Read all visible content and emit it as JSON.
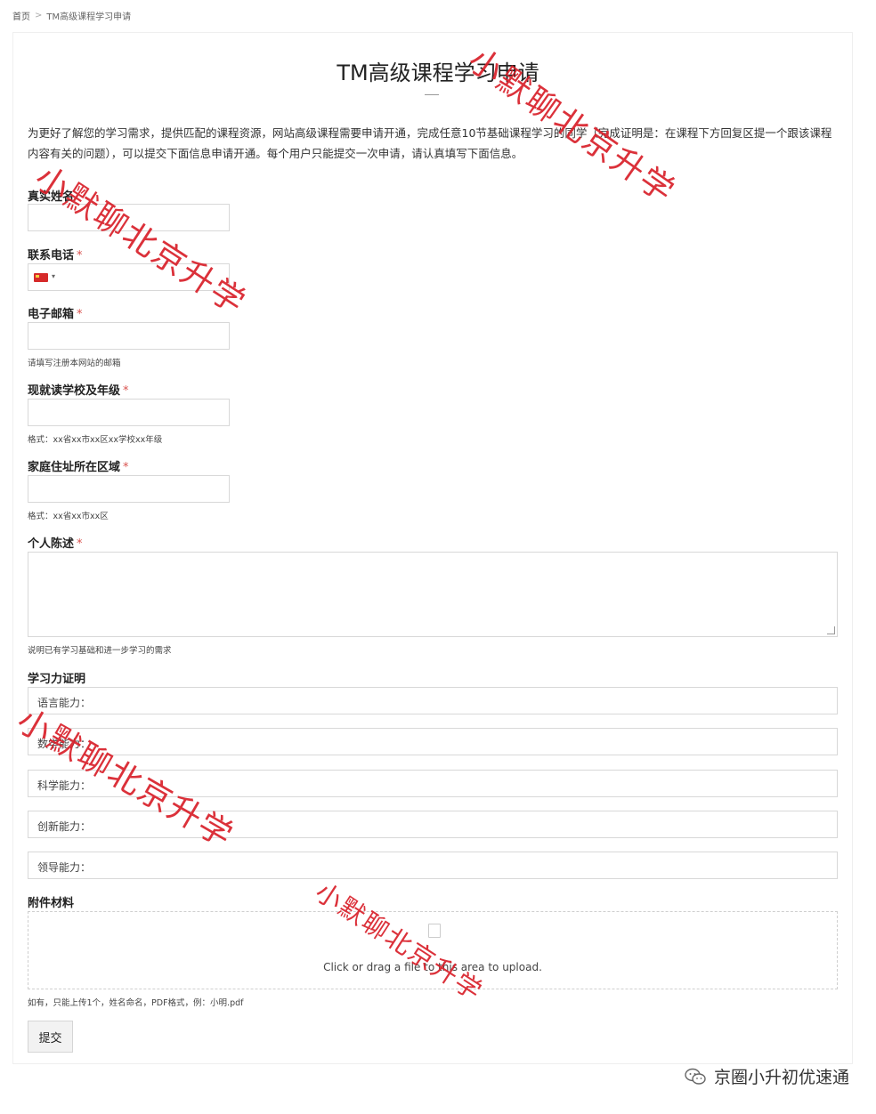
{
  "breadcrumb": {
    "home": "首页",
    "current": "TM高级课程学习申请"
  },
  "page": {
    "title": "TM高级课程学习申请",
    "intro": "为更好了解您的学习需求，提供匹配的课程资源，网站高级课程需要申请开通，完成任意10节基础课程学习的同学（完成证明是：在课程下方回复区提一个跟该课程内容有关的问题），可以提交下面信息申请开通。每个用户只能提交一次申请，请认真填写下面信息。"
  },
  "form": {
    "name_label": "真实姓名",
    "phone_label": "联系电话",
    "email_label": "电子邮箱",
    "email_hint": "请填写注册本网站的邮箱",
    "school_label": "现就读学校及年级",
    "school_hint": "格式：xx省xx市xx区xx学校xx年级",
    "address_label": "家庭住址所在区域",
    "address_hint": "格式：xx省xx市xx区",
    "statement_label": "个人陈述",
    "statement_hint": "说明已有学习基础和进一步学习的需求",
    "ability_label": "学习力证明",
    "abilities": [
      "语言能力：",
      "数学能力：",
      "科学能力：",
      "创新能力：",
      "领导能力："
    ],
    "attachment_label": "附件材料",
    "upload_text": "Click or drag a file to this area to upload.",
    "attachment_hint": "如有，只能上传1个，姓名命名，PDF格式，例：小明.pdf",
    "required_mark": "*",
    "submit_label": "提交"
  },
  "watermark": {
    "text": "小默聊北京升学",
    "color": "#d9202a"
  },
  "footer": {
    "brand": "京圈小升初优速通"
  }
}
